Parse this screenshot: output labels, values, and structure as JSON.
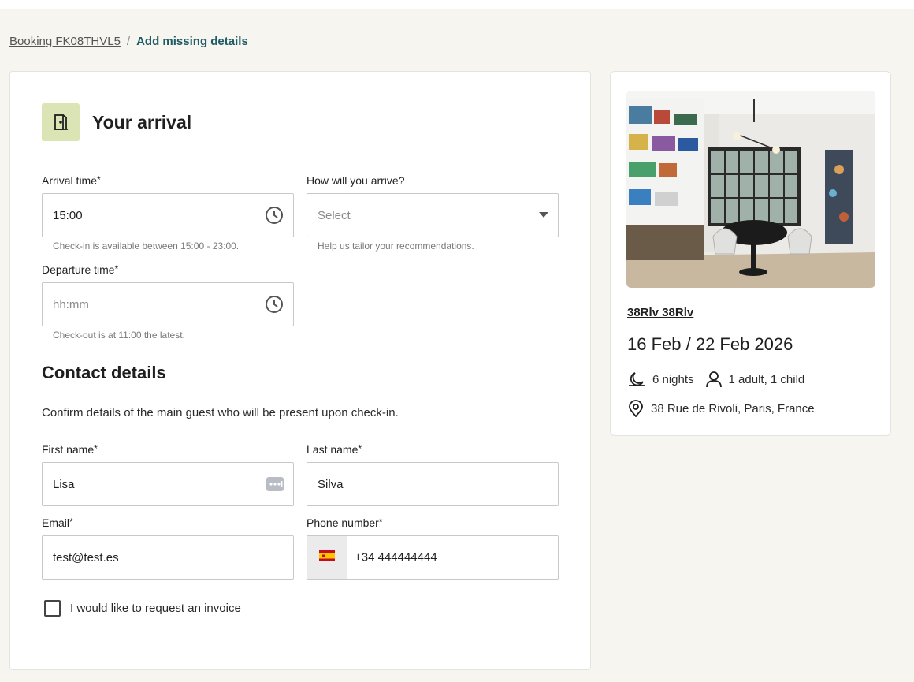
{
  "breadcrumb": {
    "booking_link": "Booking FK08THVL5",
    "separator": "/",
    "current": "Add missing details"
  },
  "arrival": {
    "title": "Your arrival",
    "section_icon": "door-icon",
    "arrival_time": {
      "label": "Arrival time",
      "required": "*",
      "value": "15:00",
      "hint": "Check-in is available between 15:00 - 23:00.",
      "icon": "clock-icon"
    },
    "how_arrive": {
      "label": "How will you arrive?",
      "placeholder": "Select",
      "hint": "Help us tailor your recommendations.",
      "icon": "caret-down-icon"
    },
    "departure_time": {
      "label": "Departure time",
      "required": "*",
      "placeholder": "hh:mm",
      "hint": "Check-out is at 11:00 the latest.",
      "icon": "clock-icon"
    }
  },
  "contact": {
    "title": "Contact details",
    "description": "Confirm details of the main guest who will be present upon check-in.",
    "first_name": {
      "label": "First name",
      "required": "*",
      "value": "Lisa",
      "icon": "password-manager-icon"
    },
    "last_name": {
      "label": "Last name",
      "required": "*",
      "value": "Silva"
    },
    "email": {
      "label": "Email",
      "required": "*",
      "value": "test@test.es"
    },
    "phone": {
      "label": "Phone number",
      "required": "*",
      "value": "+34 444444444",
      "flag": "spain-flag-icon"
    },
    "invoice_checkbox": {
      "label": "I would like to request an invoice",
      "checked": false
    }
  },
  "summary": {
    "property_name": "38Rlv 38Rlv",
    "dates": "16 Feb / 22 Feb 2026",
    "nights": "6 nights",
    "guests": "1 adult, 1 child",
    "address": "38 Rue de Rivoli, Paris, France"
  },
  "colors": {
    "accent": "#1e5b66",
    "section_icon_bg": "#dbe4b4",
    "page_bg": "#f6f5f0"
  }
}
